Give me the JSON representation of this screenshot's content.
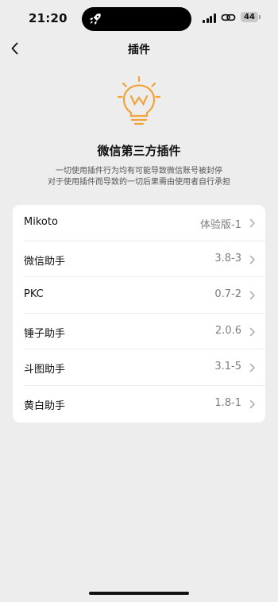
{
  "status_bar": {
    "time": "21:20",
    "battery_level": "44"
  },
  "nav": {
    "title": "插件"
  },
  "hero": {
    "icon": "lightbulb-icon",
    "title": "微信第三方插件",
    "desc_line1": "一切使用插件行为均有可能导致微信账号被封停",
    "desc_line2": "对于使用插件而导致的一切后果需由使用者自行承担"
  },
  "plugins": [
    {
      "name": "Mikoto",
      "version": "体验版-1"
    },
    {
      "name": "微信助手",
      "version": "3.8-3"
    },
    {
      "name": "PKC",
      "version": "0.7-2"
    },
    {
      "name": "锤子助手",
      "version": "2.0.6"
    },
    {
      "name": "斗图助手",
      "version": "3.1-5"
    },
    {
      "name": "黄白助手",
      "version": "1.8-1"
    }
  ],
  "colors": {
    "background": "#ededed",
    "card": "#ffffff",
    "accent_orange": "#f2a33a",
    "secondary_text": "#7d7d7d"
  }
}
